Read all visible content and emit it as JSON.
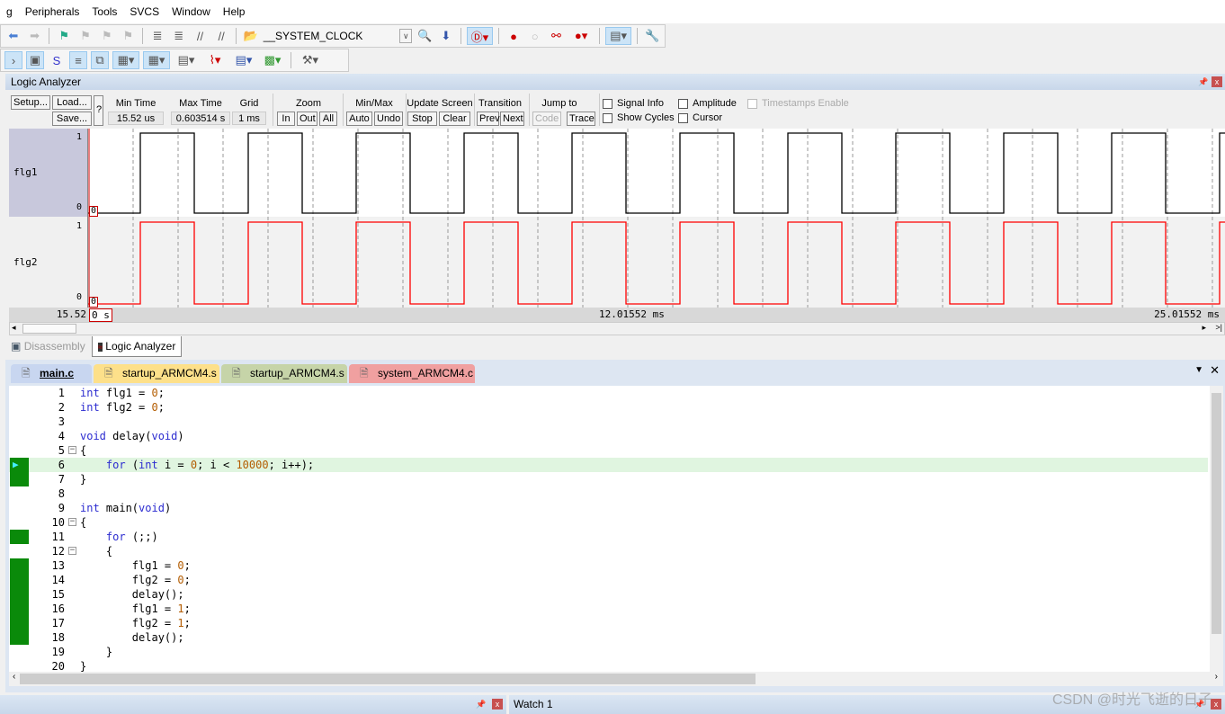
{
  "menu": [
    "g",
    "Peripherals",
    "Tools",
    "SVCS",
    "Window",
    "Help"
  ],
  "toolbar": {
    "target": "__SYSTEM_CLOCK"
  },
  "la": {
    "title": "Logic Analyzer",
    "setup": "Setup...",
    "load": "Load...",
    "save": "Save...",
    "help": "?",
    "min_time_label": "Min Time",
    "min_time": "15.52 us",
    "max_time_label": "Max Time",
    "max_time": "0.603514 s",
    "grid_label": "Grid",
    "grid": "1 ms",
    "zoom_label": "Zoom",
    "zoom_in": "In",
    "zoom_out": "Out",
    "zoom_all": "All",
    "minmax_label": "Min/Max",
    "auto": "Auto",
    "undo": "Undo",
    "update_label": "Update Screen",
    "stop": "Stop",
    "clear": "Clear",
    "transition_label": "Transition",
    "prev": "Prev",
    "next": "Next",
    "jump_label": "Jump to",
    "code": "Code",
    "trace": "Trace",
    "signal_info": "Signal Info",
    "amplitude": "Amplitude",
    "timestamps": "Timestamps Enable",
    "show_cycles": "Show Cycles",
    "cursor": "Cursor",
    "signals": [
      {
        "name": "flg1",
        "hi": "1",
        "lo": "0",
        "value": "0",
        "color": "#000000"
      },
      {
        "name": "flg2",
        "hi": "1",
        "lo": "0",
        "value": "0",
        "color": "#ff0000"
      }
    ],
    "time_left": "15.52",
    "time_cursor": "0 s",
    "time_mid": "12.01552 ms",
    "time_right": "25.01552 ms",
    "waveform": {
      "period_ms": 2.4,
      "first_rise_ms": 1.16
    }
  },
  "bottom_tabs": [
    "Disassembly",
    "Logic Analyzer"
  ],
  "file_tabs": [
    {
      "label": "main.c",
      "color": "#c8d6f0"
    },
    {
      "label": "startup_ARMCM4.s",
      "color": "#fde08a"
    },
    {
      "label": "startup_ARMCM4.s",
      "color": "#c6d4a8"
    },
    {
      "label": "system_ARMCM4.c",
      "color": "#f0a0a0"
    }
  ],
  "code": [
    [
      [
        "int",
        "kw"
      ],
      [
        " flg1 = ",
        "pl"
      ],
      [
        "0",
        "num"
      ],
      [
        ";",
        "pl"
      ]
    ],
    [
      [
        "int",
        "kw"
      ],
      [
        " flg2 = ",
        "pl"
      ],
      [
        "0",
        "num"
      ],
      [
        ";",
        "pl"
      ]
    ],
    [],
    [
      [
        "void",
        "kw"
      ],
      [
        " delay(",
        "pl"
      ],
      [
        "void",
        "kw"
      ],
      [
        ")",
        "pl"
      ]
    ],
    [
      [
        "{",
        "pl"
      ]
    ],
    [
      [
        "    ",
        "pl"
      ],
      [
        "for",
        "kw"
      ],
      [
        " (",
        "pl"
      ],
      [
        "int",
        "kw"
      ],
      [
        " i = ",
        "pl"
      ],
      [
        "0",
        "num"
      ],
      [
        "; i < ",
        "pl"
      ],
      [
        "10000",
        "num"
      ],
      [
        "; i++);",
        "pl"
      ]
    ],
    [
      [
        "}",
        "pl"
      ]
    ],
    [],
    [
      [
        "int",
        "kw"
      ],
      [
        " main(",
        "pl"
      ],
      [
        "void",
        "kw"
      ],
      [
        ")",
        "pl"
      ]
    ],
    [
      [
        "{",
        "pl"
      ]
    ],
    [
      [
        "    ",
        "pl"
      ],
      [
        "for",
        "kw"
      ],
      [
        " (;;)",
        "pl"
      ]
    ],
    [
      [
        "    {",
        "pl"
      ]
    ],
    [
      [
        "        flg1 = ",
        "pl"
      ],
      [
        "0",
        "num"
      ],
      [
        ";",
        "pl"
      ]
    ],
    [
      [
        "        flg2 = ",
        "pl"
      ],
      [
        "0",
        "num"
      ],
      [
        ";",
        "pl"
      ]
    ],
    [
      [
        "        delay();",
        "pl"
      ]
    ],
    [
      [
        "        flg1 = ",
        "pl"
      ],
      [
        "1",
        "num"
      ],
      [
        ";",
        "pl"
      ]
    ],
    [
      [
        "        flg2 = ",
        "pl"
      ],
      [
        "1",
        "num"
      ],
      [
        ";",
        "pl"
      ]
    ],
    [
      [
        "        delay();",
        "pl"
      ]
    ],
    [
      [
        "    }",
        "pl"
      ]
    ],
    [
      [
        "}",
        "pl"
      ]
    ]
  ],
  "current_line": 6,
  "executed_lines": [
    6,
    7,
    11,
    13,
    14,
    15,
    16,
    17,
    18
  ],
  "fold_lines": [
    5,
    10,
    12
  ],
  "watch": {
    "title": "Watch 1"
  },
  "watermark": "CSDN @时光飞逝的日子"
}
